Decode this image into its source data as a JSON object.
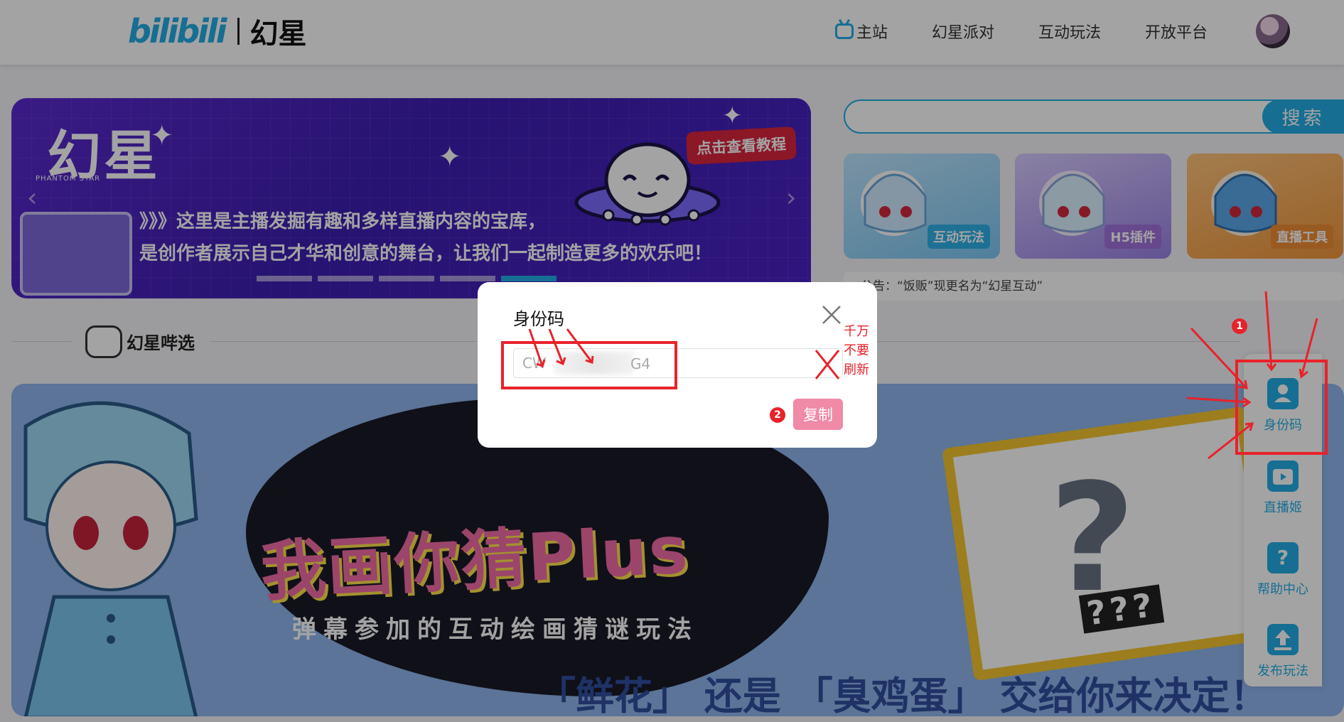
{
  "header": {
    "logo_bili": "bilibili",
    "logo_name": "幻星",
    "nav": [
      "主站",
      "幻星派对",
      "互动玩法",
      "开放平台"
    ],
    "brand_color": "#23ade5"
  },
  "banner": {
    "logo": "幻星",
    "logo_sub": "PHANTOM STAR",
    "line1": "》》》这里是主播发掘有趣和多样直播内容的宝库，",
    "line2": "是创作者展示自己才华和创意的舞台，让我们一起制造更多的欢乐吧！",
    "badge": "点击查看教程"
  },
  "search": {
    "placeholder": "",
    "button": "搜索"
  },
  "cards": [
    {
      "label": "互动玩法",
      "color": "#23ade5"
    },
    {
      "label": "H5插件",
      "color": "#b278d6"
    },
    {
      "label": "直播工具",
      "color": "#f29b38"
    }
  ],
  "notice": "公告：“饭贩”现更名为“幻星互动”",
  "section": {
    "title": "幻星哔选"
  },
  "feature": {
    "title": "我画你猜Plus",
    "subtitle": "弹幕参加的互动绘画猜谜玩法",
    "bottom_line": "「鲜花」 还是 「臭鸡蛋」 交给你来决定！",
    "question_marks": "???"
  },
  "sidebar": {
    "items": [
      {
        "label": "身份码",
        "icon": "id-card-icon"
      },
      {
        "label": "直播姬",
        "icon": "tv-icon"
      },
      {
        "label": "帮助中心",
        "icon": "help-icon"
      },
      {
        "label": "发布玩法",
        "icon": "upload-icon"
      }
    ]
  },
  "modal": {
    "title": "身份码",
    "code_prefix": "CW",
    "code_suffix": "G4",
    "copy_button": "复制"
  },
  "annotations": {
    "step1": "1",
    "step2": "2",
    "warning_line1": "千万",
    "warning_line2": "不要",
    "warning_line3": "刷新"
  }
}
